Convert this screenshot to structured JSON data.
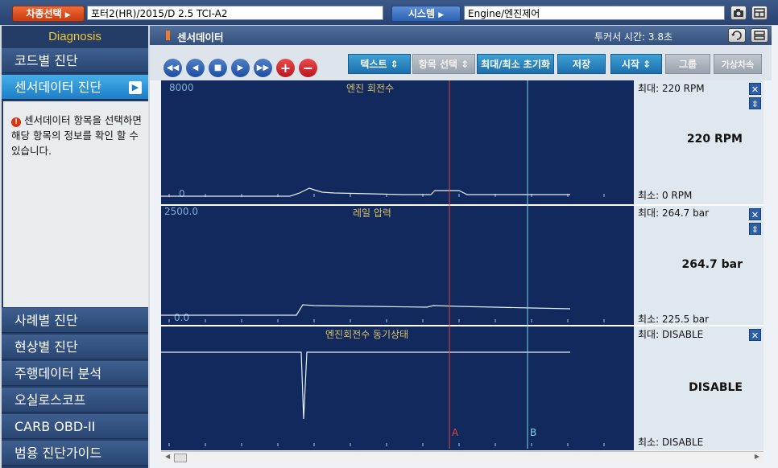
{
  "topbar": {
    "vehicle_button": "차종선택",
    "vehicle_value": "포터2(HR)/2015/D 2.5 TCI-A2",
    "system_button": "시스템",
    "system_value": "Engine/엔진제어"
  },
  "sidebar": {
    "header": "Diagnosis",
    "items": [
      {
        "label": "코드별 진단"
      },
      {
        "label": "센서데이터 진단"
      },
      {
        "label": "사례별 진단"
      },
      {
        "label": "현상별 진단"
      },
      {
        "label": "주행데이터 분석"
      },
      {
        "label": "오실로스코프"
      },
      {
        "label": "CARB OBD-II"
      },
      {
        "label": "범용 진단가이드"
      }
    ],
    "info_text": "센서데이터 항목을 선택하면 해당 항목의 정보를 확인 할 수 있습니다."
  },
  "window": {
    "title": "센서데이터",
    "cursor_time": "투커서 시간: 3.8초"
  },
  "toolbar": {
    "text_button": "텍스트",
    "item_select": "항목 선택",
    "reset_minmax": "최대/최소 초기화",
    "save": "저장",
    "start": "시작",
    "group": "그룹",
    "virtual": "가상차속"
  },
  "panels": [
    {
      "label": "엔진 회전수",
      "scale_max": "8000",
      "scale_min": "0",
      "max_text": "최대:   220 RPM",
      "value": "220 RPM",
      "min_text": "최소:     0 RPM"
    },
    {
      "label": "레일 압력",
      "scale_max": "2500.0",
      "scale_min": "0.0",
      "max_text": "최대: 264.7 bar",
      "value": "264.7 bar",
      "min_text": "최소: 225.5 bar"
    },
    {
      "label": "엔진회전수 동기상태",
      "scale_max": "",
      "scale_min": "",
      "max_text": "최대: DISABLE",
      "value": "DISABLE",
      "min_text": "최소: DISABLE"
    }
  ],
  "cursors": {
    "a": "A",
    "b": "B"
  },
  "colors": {
    "panel_bg": "#11295c",
    "cursor_a": "#e0463c",
    "cursor_b": "#7fd6ee",
    "trace": "#e8eef6"
  }
}
